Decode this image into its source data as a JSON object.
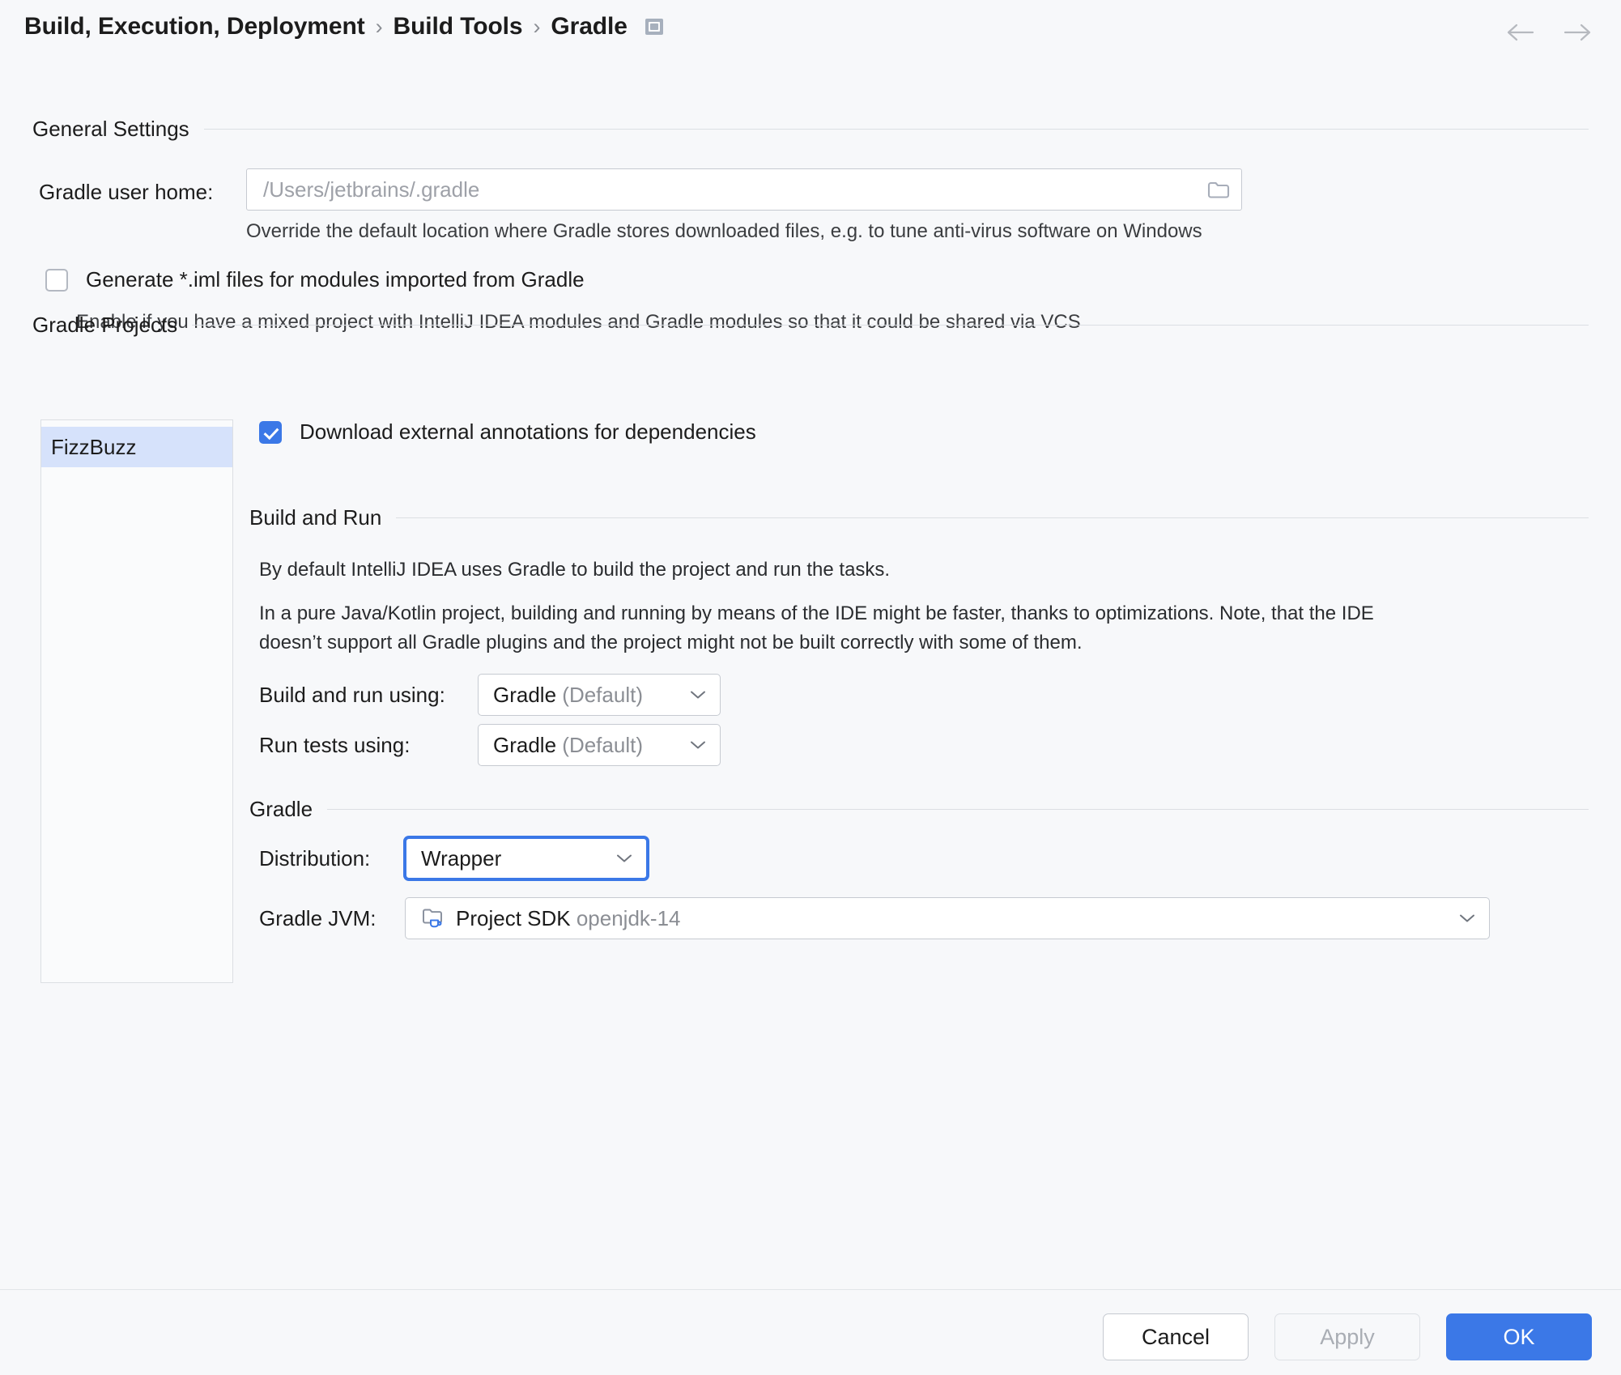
{
  "header": {
    "breadcrumb": [
      "Build, Execution, Deployment",
      "Build Tools",
      "Gradle"
    ],
    "separator": "›",
    "badge_icon": "screen-icon",
    "back_icon": "arrow-left-icon",
    "forward_icon": "arrow-right-icon"
  },
  "general": {
    "title": "General Settings",
    "gradle_user_home": {
      "label": "Gradle user home:",
      "value": "/Users/jetbrains/.gradle",
      "placeholder": "/Users/jetbrains/.gradle",
      "browse_icon": "folder-icon",
      "hint": "Override the default location where Gradle stores downloaded files, e.g. to tune anti-virus software on Windows"
    },
    "generate_iml": {
      "label": "Generate *.iml files for modules imported from Gradle",
      "checked": false,
      "hint": "Enable if you have a mixed project with IntelliJ IDEA modules and Gradle modules so that it could be shared via VCS"
    }
  },
  "projects": {
    "title": "Gradle Projects",
    "items": [
      {
        "label": "FizzBuzz",
        "selected": true
      }
    ]
  },
  "details": {
    "download_annotations": {
      "label": "Download external annotations for dependencies",
      "checked": true
    },
    "build_and_run": {
      "title": "Build and Run",
      "paragraph_1": "By default IntelliJ IDEA uses Gradle to build the project and run the tasks.",
      "paragraph_2": "In a pure Java/Kotlin project, building and running by means of the IDE might be faster, thanks to optimizations. Note, that the IDE doesn’t support all Gradle plugins and the project might not be built correctly with some of them.",
      "build_using": {
        "label": "Build and run using:",
        "value": "Gradle",
        "value_suffix": "(Default)"
      },
      "tests_using": {
        "label": "Run tests using:",
        "value": "Gradle",
        "value_suffix": "(Default)"
      }
    },
    "gradle": {
      "title": "Gradle",
      "distribution": {
        "label": "Distribution:",
        "value": "Wrapper",
        "focused": true
      },
      "gradle_jvm": {
        "label": "Gradle JVM:",
        "icon": "sdk-folder-java-icon",
        "value": "Project SDK",
        "value_suffix": "openjdk-14"
      }
    }
  },
  "footer": {
    "cancel_label": "Cancel",
    "apply_label": "Apply",
    "apply_enabled": false,
    "ok_label": "OK"
  },
  "colors": {
    "accent": "#3b78e7",
    "selection": "#d6e2fb",
    "background": "#f7f8fa",
    "border": "#c6cad1"
  }
}
